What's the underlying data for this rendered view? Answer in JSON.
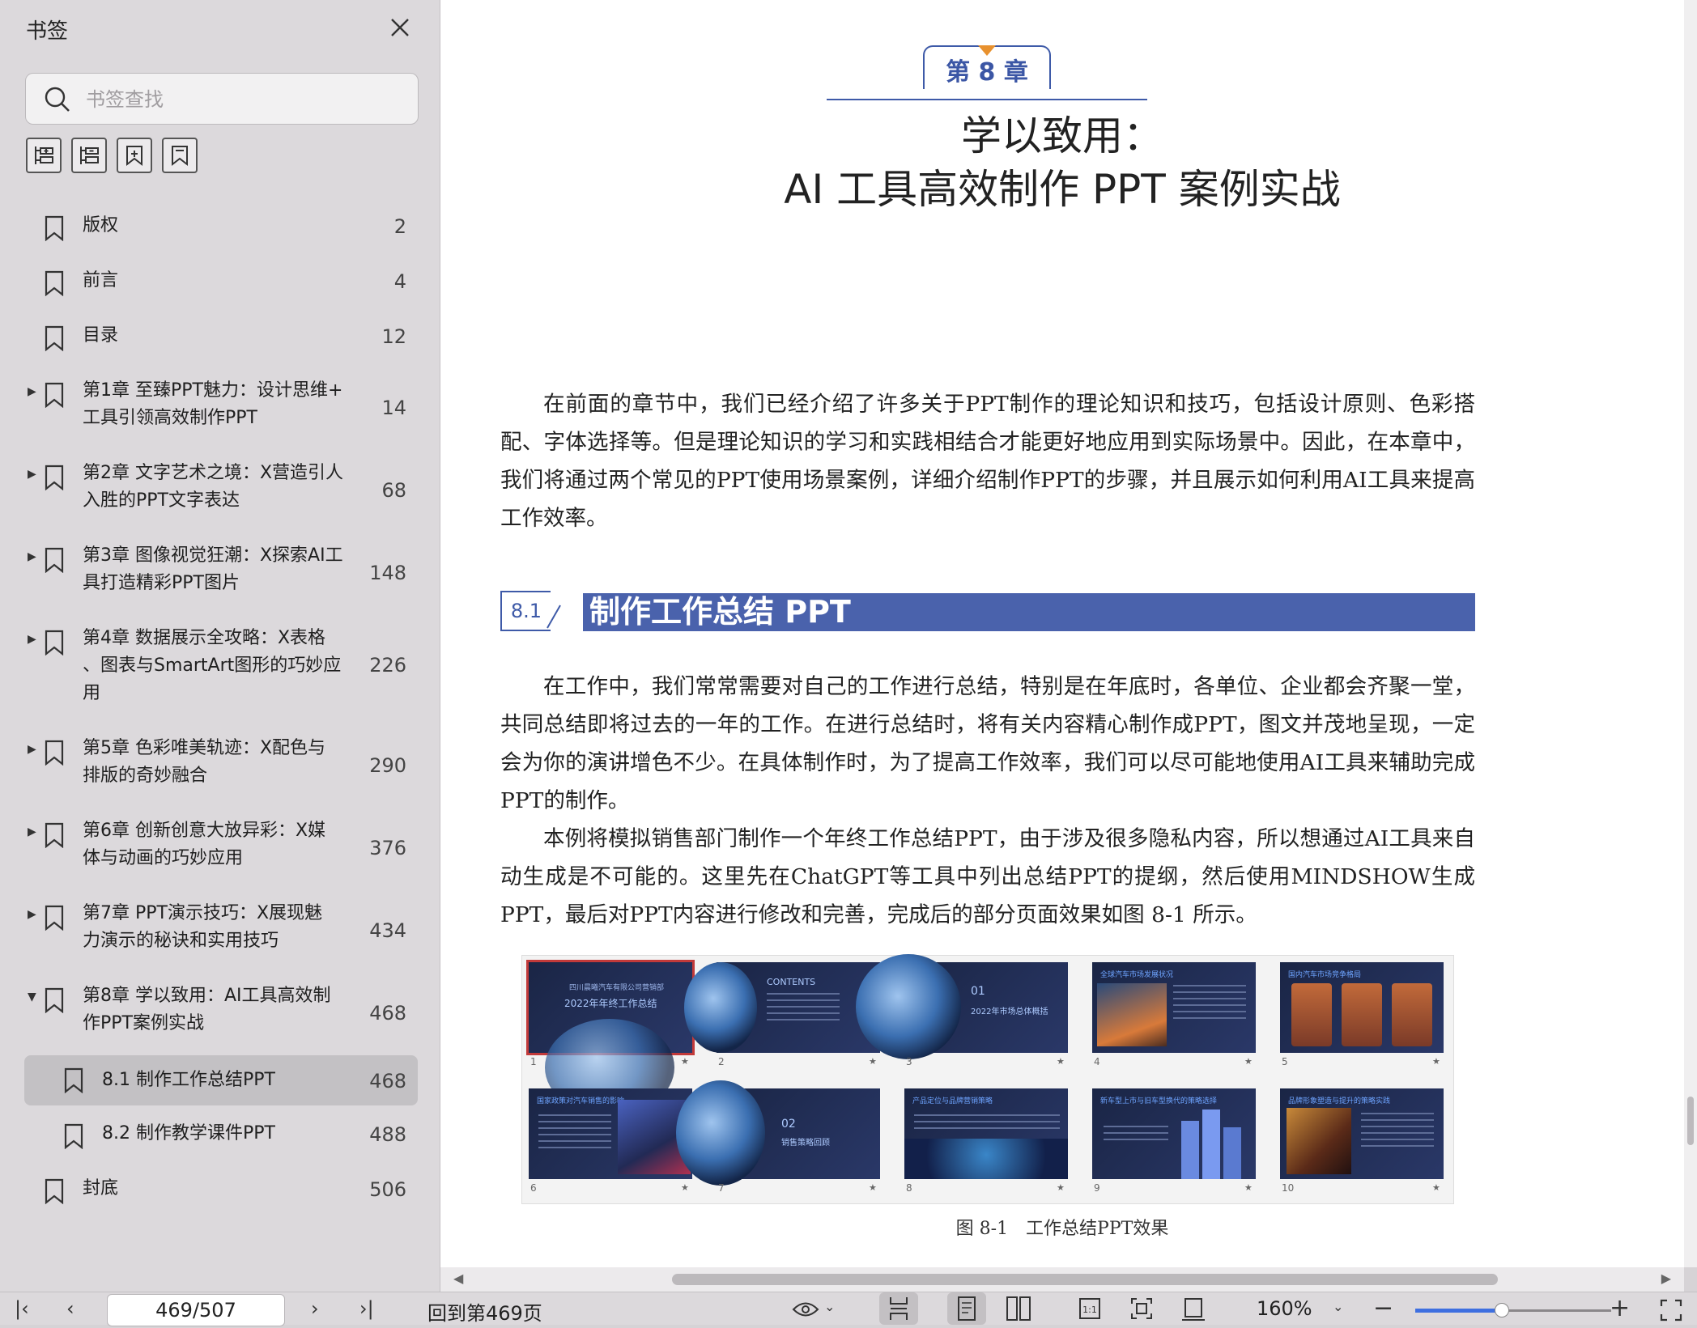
{
  "sidebar": {
    "title": "书签",
    "search_placeholder": "书签查找",
    "bookmarks": [
      {
        "label": "版权",
        "page": "2"
      },
      {
        "label": "前言",
        "page": "4"
      },
      {
        "label": "目录",
        "page": "12"
      },
      {
        "label": "第1章 至臻PPT魅力：设计思维+工具引领高效制作PPT",
        "line1": "第1章 至臻PPT魅力：设计思维+",
        "line2": "工具引领高效制作PPT",
        "page": "14"
      },
      {
        "label": "第2章 文字艺术之境：X营造引人入胜的PPT文字表达",
        "line1": "第2章 文字艺术之境：X营造引人",
        "line2": "入胜的PPT文字表达",
        "page": "68"
      },
      {
        "label": "第3章 图像视觉狂潮：X探索AI工具打造精彩PPT图片",
        "line1": "第3章 图像视觉狂潮：X探索AI工",
        "line2": "具打造精彩PPT图片",
        "page": "148"
      },
      {
        "label": "第4章 数据展示全攻略：X表格、图表与SmartArt图形的巧妙应用",
        "line1": "第4章 数据展示全攻略：X表格",
        "line2": "、图表与SmartArt图形的巧妙应",
        "line3": "用",
        "page": "226"
      },
      {
        "label": "第5章 色彩唯美轨迹：X配色与排版的奇妙融合",
        "line1": "第5章 色彩唯美轨迹：X配色与",
        "line2": "排版的奇妙融合",
        "page": "290"
      },
      {
        "label": "第6章 创新创意大放异彩：X媒体与动画的巧妙应用",
        "line1": "第6章 创新创意大放异彩：X媒",
        "line2": "体与动画的巧妙应用",
        "page": "376"
      },
      {
        "label": "第7章 PPT演示技巧：X展现魅力演示的秘诀和实用技巧",
        "line1": "第7章 PPT演示技巧：X展现魅",
        "line2": "力演示的秘诀和实用技巧",
        "page": "434"
      },
      {
        "label": "第8章 学以致用：AI工具高效制作PPT案例实战",
        "line1": "第8章 学以致用：AI工具高效制",
        "line2": "作PPT案例实战",
        "page": "468"
      },
      {
        "label": "8.1 制作工作总结PPT",
        "page": "468"
      },
      {
        "label": "8.2 制作教学课件PPT",
        "page": "488"
      },
      {
        "label": "封底",
        "page": "506"
      }
    ]
  },
  "document": {
    "chapter_tab": "第 8 章",
    "title_line1": "学以致用：",
    "title_line2": "AI 工具高效制作 PPT 案例实战",
    "intro_paragraph": "在前面的章节中，我们已经介绍了许多关于PPT制作的理论知识和技巧，包括设计原则、色彩搭配、字体选择等。但是理论知识的学习和实践相结合才能更好地应用到实际场景中。因此，在本章中，我们将通过两个常见的PPT使用场景案例，详细介绍制作PPT的步骤，并且展示如何利用AI工具来提高工作效率。",
    "section_number": "8.1",
    "section_title": "制作工作总结 PPT",
    "section_para1": "在工作中，我们常常需要对自己的工作进行总结，特别是在年底时，各单位、企业都会齐聚一堂，共同总结即将过去的一年的工作。在进行总结时，将有关内容精心制作成PPT，图文并茂地呈现，一定会为你的演讲增色不少。在具体制作时，为了提高工作效率，我们可以尽可能地使用AI工具来辅助完成PPT的制作。",
    "section_para2": "本例将模拟销售部门制作一个年终工作总结PPT，由于涉及很多隐私内容，所以想通过AI工具来自动生成是不可能的。这里先在ChatGPT等工具中列出总结PPT的提纲，然后使用MINDSHOW生成PPT，最后对PPT内容进行修改和完善，完成后的部分页面效果如图 8-1 所示。",
    "figure_caption": "图 8-1　工作总结PPT效果",
    "slides": [
      {
        "num": "1",
        "title": "四川晨曦汽车有限公司营销部",
        "big": "2022年年终工作总结"
      },
      {
        "num": "2",
        "title": "",
        "big": "CONTENTS"
      },
      {
        "num": "3",
        "title": "",
        "big": "01",
        "sub": "2022年市场总体概括"
      },
      {
        "num": "4",
        "title": "全球汽车市场发展状况",
        "big": ""
      },
      {
        "num": "5",
        "title": "国内汽车市场竞争格局",
        "big": ""
      },
      {
        "num": "6",
        "title": "国家政策对汽车销售的影响",
        "big": ""
      },
      {
        "num": "7",
        "title": "",
        "big": "02",
        "sub": "销售策略回顾"
      },
      {
        "num": "8",
        "title": "产品定位与品牌营销策略",
        "big": ""
      },
      {
        "num": "9",
        "title": "新车型上市与旧车型换代的策略选择",
        "big": ""
      },
      {
        "num": "10",
        "title": "品牌形象塑造与提升的策略实践",
        "big": ""
      }
    ]
  },
  "statusbar": {
    "page_value": "469/507",
    "goto_label": "回到第469页",
    "zoom_label": "160%",
    "zoom_fraction": 0.44
  },
  "colors": {
    "accent_blue": "#3e5aa8",
    "section_bar": "#4a62ac",
    "chapter_triangle": "#e8912e",
    "selected_slide_border": "#c23a3a",
    "zoom_fill": "#3e6fe0"
  }
}
